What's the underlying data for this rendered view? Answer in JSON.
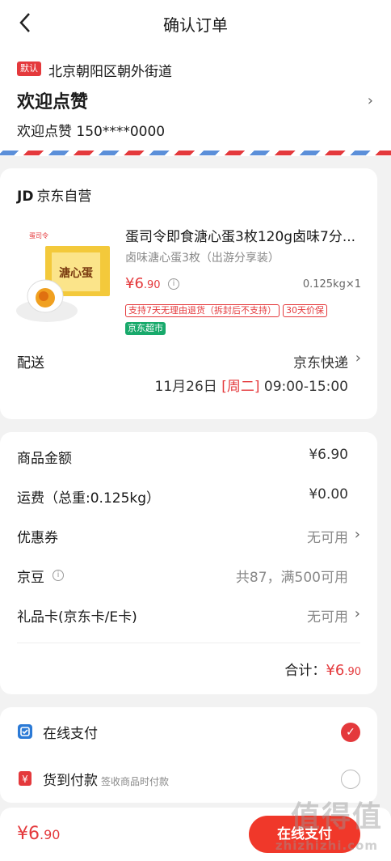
{
  "header": {
    "title": "确认订单"
  },
  "address": {
    "badge": "默认",
    "line": "北京朝阳区朝外街道",
    "name": "欢迎点赞",
    "contact": "欢迎点赞 150****0000"
  },
  "store": {
    "logo": "JD",
    "name": "京东自营"
  },
  "product": {
    "title": "蛋司令即食溏心蛋3枚120g卤味7分...",
    "spec": "卤味溏心蛋3枚（出游分享装）",
    "price_symbol": "¥",
    "price_int": "6",
    "price_dec": ".90",
    "qty": "0.125kg×1",
    "tags": [
      "支持7天无理由退货（拆封后不支持）",
      "30天价保"
    ],
    "market_tag": "京东超市",
    "image_text": "溏心蛋"
  },
  "shipping": {
    "label": "配送",
    "method": "京东快递",
    "date": "11月26日",
    "weekday": "[周二]",
    "time": "09:00-15:00"
  },
  "summary": {
    "rows": [
      {
        "label": "商品金额",
        "value": "¥6.90"
      },
      {
        "label": "运费（总重:0.125kg）",
        "value": "¥0.00"
      },
      {
        "label": "优惠券",
        "value": "无可用"
      },
      {
        "label": "京豆",
        "value": "共87，满500可用"
      },
      {
        "label": "礼品卡(京东卡/E卡)",
        "value": "无可用"
      }
    ],
    "total_label": "合计：",
    "total_symbol": "¥",
    "total_int": "6",
    "total_dec": ".90"
  },
  "payment": {
    "online": "在线支付",
    "cod": "货到付款",
    "cod_hint": "签收商品时付款",
    "selected": "online"
  },
  "bottom": {
    "price_symbol": "¥",
    "price_int": "6",
    "price_dec": ".90",
    "pay_button": "在线支付"
  },
  "watermark": {
    "main": "值得值",
    "sub": "zhizhizhi.com"
  },
  "colors": {
    "accent": "#e4393c",
    "green": "#18a96b",
    "blue": "#5b8fd9"
  }
}
